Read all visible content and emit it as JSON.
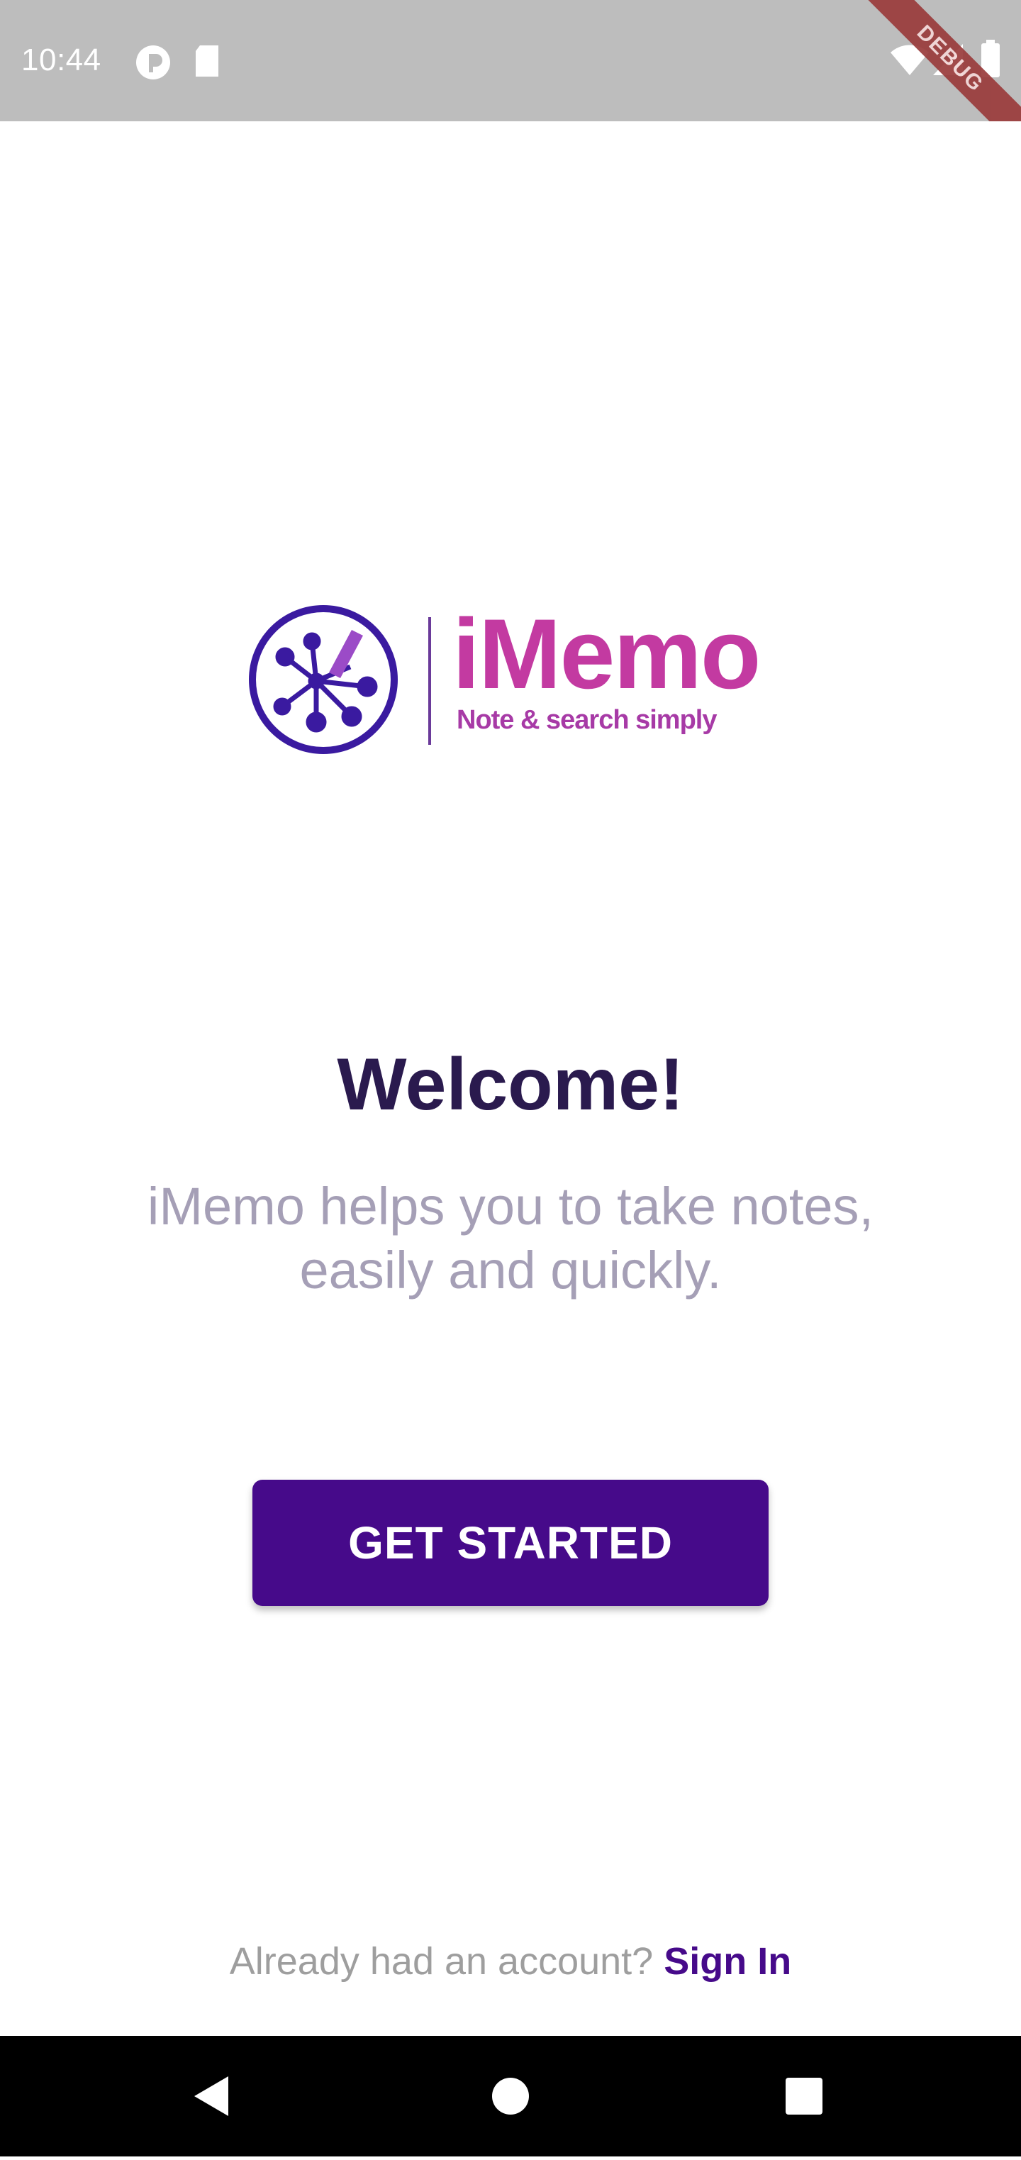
{
  "status_bar": {
    "time": "10:44",
    "debug_label": "DEBUG",
    "icons": [
      "circle-app-icon",
      "sd-card-icon",
      "wifi-icon",
      "signal-icon",
      "battery-icon"
    ]
  },
  "logo": {
    "name": "iMemo",
    "tagline": "Note & search simply",
    "colors": {
      "purple": "#3a1aa0",
      "pink": "#c33aa1"
    }
  },
  "welcome": {
    "title": "Welcome!",
    "subtitle": "iMemo helps you to take notes, easily and quickly."
  },
  "cta": {
    "label": "GET STARTED",
    "color": "#460a8a"
  },
  "signin": {
    "prompt": "Already had an account?",
    "link": "Sign In"
  },
  "nav": {
    "icons": [
      "back-icon",
      "home-icon",
      "recents-icon"
    ]
  }
}
